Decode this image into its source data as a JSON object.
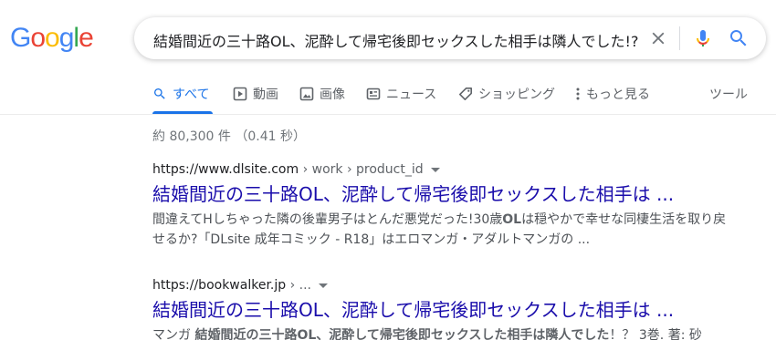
{
  "logo": {
    "letters": [
      "G",
      "o",
      "o",
      "g",
      "l",
      "e"
    ],
    "colors": [
      "#4285f4",
      "#ea4335",
      "#fbbc05",
      "#4285f4",
      "#34a853",
      "#ea4335"
    ]
  },
  "search": {
    "query": "結婚間近の三十路OL、泥酔して帰宅後即セックスした相手は隣人でした!?",
    "icons": {
      "clear": "close-icon",
      "voice": "mic-icon",
      "search": "search-icon"
    }
  },
  "tabs": [
    {
      "label": "すべて",
      "icon": "search-icon",
      "active": true
    },
    {
      "label": "動画",
      "icon": "video-icon",
      "active": false
    },
    {
      "label": "画像",
      "icon": "image-icon",
      "active": false
    },
    {
      "label": "ニュース",
      "icon": "news-icon",
      "active": false
    },
    {
      "label": "ショッピング",
      "icon": "tag-icon",
      "active": false
    },
    {
      "label": "もっと見る",
      "icon": "more-dots-icon",
      "active": false
    }
  ],
  "tools_label": "ツール",
  "result_stats": "約 80,300 件 （0.41 秒）",
  "results": [
    {
      "url_domain": "https://www.dlsite.com",
      "url_path": " › work › product_id",
      "title": "結婚間近の三十路OL、泥酔して帰宅後即セックスした相手は ...",
      "snippet_parts": [
        {
          "text": "間違えてHしちゃった隣の後輩男子はとんだ悪党だった!30歳",
          "bold": false
        },
        {
          "text": "OL",
          "bold": true
        },
        {
          "text": "は穏やかで幸せな同棲生活を取り戻せるか?「DLsite 成年コミック - R18」はエロマンガ・アダルトマンガの ...",
          "bold": false
        }
      ]
    },
    {
      "url_domain": "https://bookwalker.jp",
      "url_path": " › ...",
      "title": "結婚間近の三十路OL、泥酔して帰宅後即セックスした相手は ...",
      "snippet_parts": [
        {
          "text": "マンガ ",
          "bold": false
        },
        {
          "text": "結婚間近の三十路OL、泥酔して帰宅後即セックスした相手は隣人でした",
          "bold": true
        },
        {
          "text": "！？ 3巻. 著: 砂",
          "bold": false
        }
      ]
    }
  ],
  "colors": {
    "accent": "#1a73e8",
    "link": "#1a0dab",
    "snippet": "#4d5156",
    "muted": "#70757a"
  }
}
